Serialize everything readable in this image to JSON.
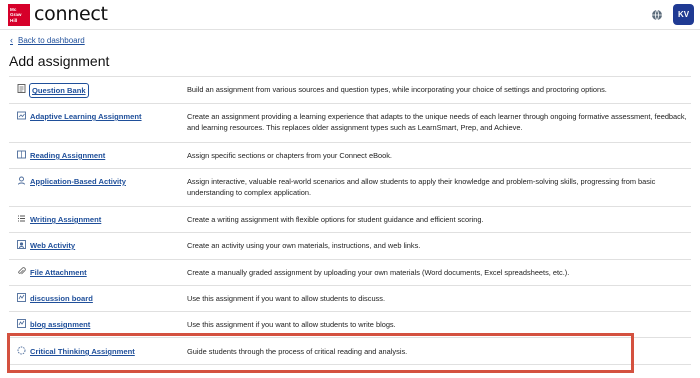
{
  "header": {
    "logo_lines": [
      "Mc",
      "Graw",
      "Hill"
    ],
    "brand": "connect",
    "globe_icon": "globe-icon",
    "avatar_initials": "KV"
  },
  "nav": {
    "back_label": "Back to dashboard"
  },
  "page": {
    "title": "Add assignment"
  },
  "colors": {
    "link": "#1f4f9a",
    "brand_red": "#d6002a",
    "avatar": "#1f3a93",
    "highlight": "#d4513f"
  },
  "assignments": [
    {
      "name": "Question Bank",
      "icon": "question-bank-icon",
      "description": "Build an assignment from various sources and question types, while incorporating your choice of settings and proctoring options."
    },
    {
      "name": "Adaptive Learning Assignment",
      "icon": "adaptive-learning-icon",
      "description": "Create an assignment providing a learning experience that adapts to the unique needs of each learner through ongoing formative assessment, feedback, and learning resources. This replaces older assignment types such as LearnSmart, Prep, and Achieve."
    },
    {
      "name": "Reading Assignment",
      "icon": "reading-icon",
      "description": "Assign specific sections or chapters from your Connect eBook."
    },
    {
      "name": "Application-Based Activity",
      "icon": "application-activity-icon",
      "description": "Assign interactive, valuable real-world scenarios and allow students to apply their knowledge and problem-solving skills, progressing from basic understanding to complex application."
    },
    {
      "name": "Writing Assignment",
      "icon": "writing-icon",
      "description": "Create a writing assignment with flexible options for student guidance and efficient scoring."
    },
    {
      "name": "Web Activity",
      "icon": "web-activity-icon",
      "description": "Create an activity using your own materials, instructions, and web links."
    },
    {
      "name": "File Attachment",
      "icon": "file-attachment-icon",
      "description": "Create a manually graded assignment by uploading your own materials (Word documents, Excel spreadsheets, etc.)."
    },
    {
      "name": "discussion board",
      "icon": "discussion-board-icon",
      "description": "Use this assignment if you want to allow students to discuss."
    },
    {
      "name": "blog assignment",
      "icon": "blog-icon",
      "description": "Use this assignment if you want to allow students to write blogs."
    },
    {
      "name": "Critical Thinking Assignment",
      "icon": "critical-thinking-icon",
      "description": "Guide students through the process of critical reading and analysis."
    }
  ]
}
